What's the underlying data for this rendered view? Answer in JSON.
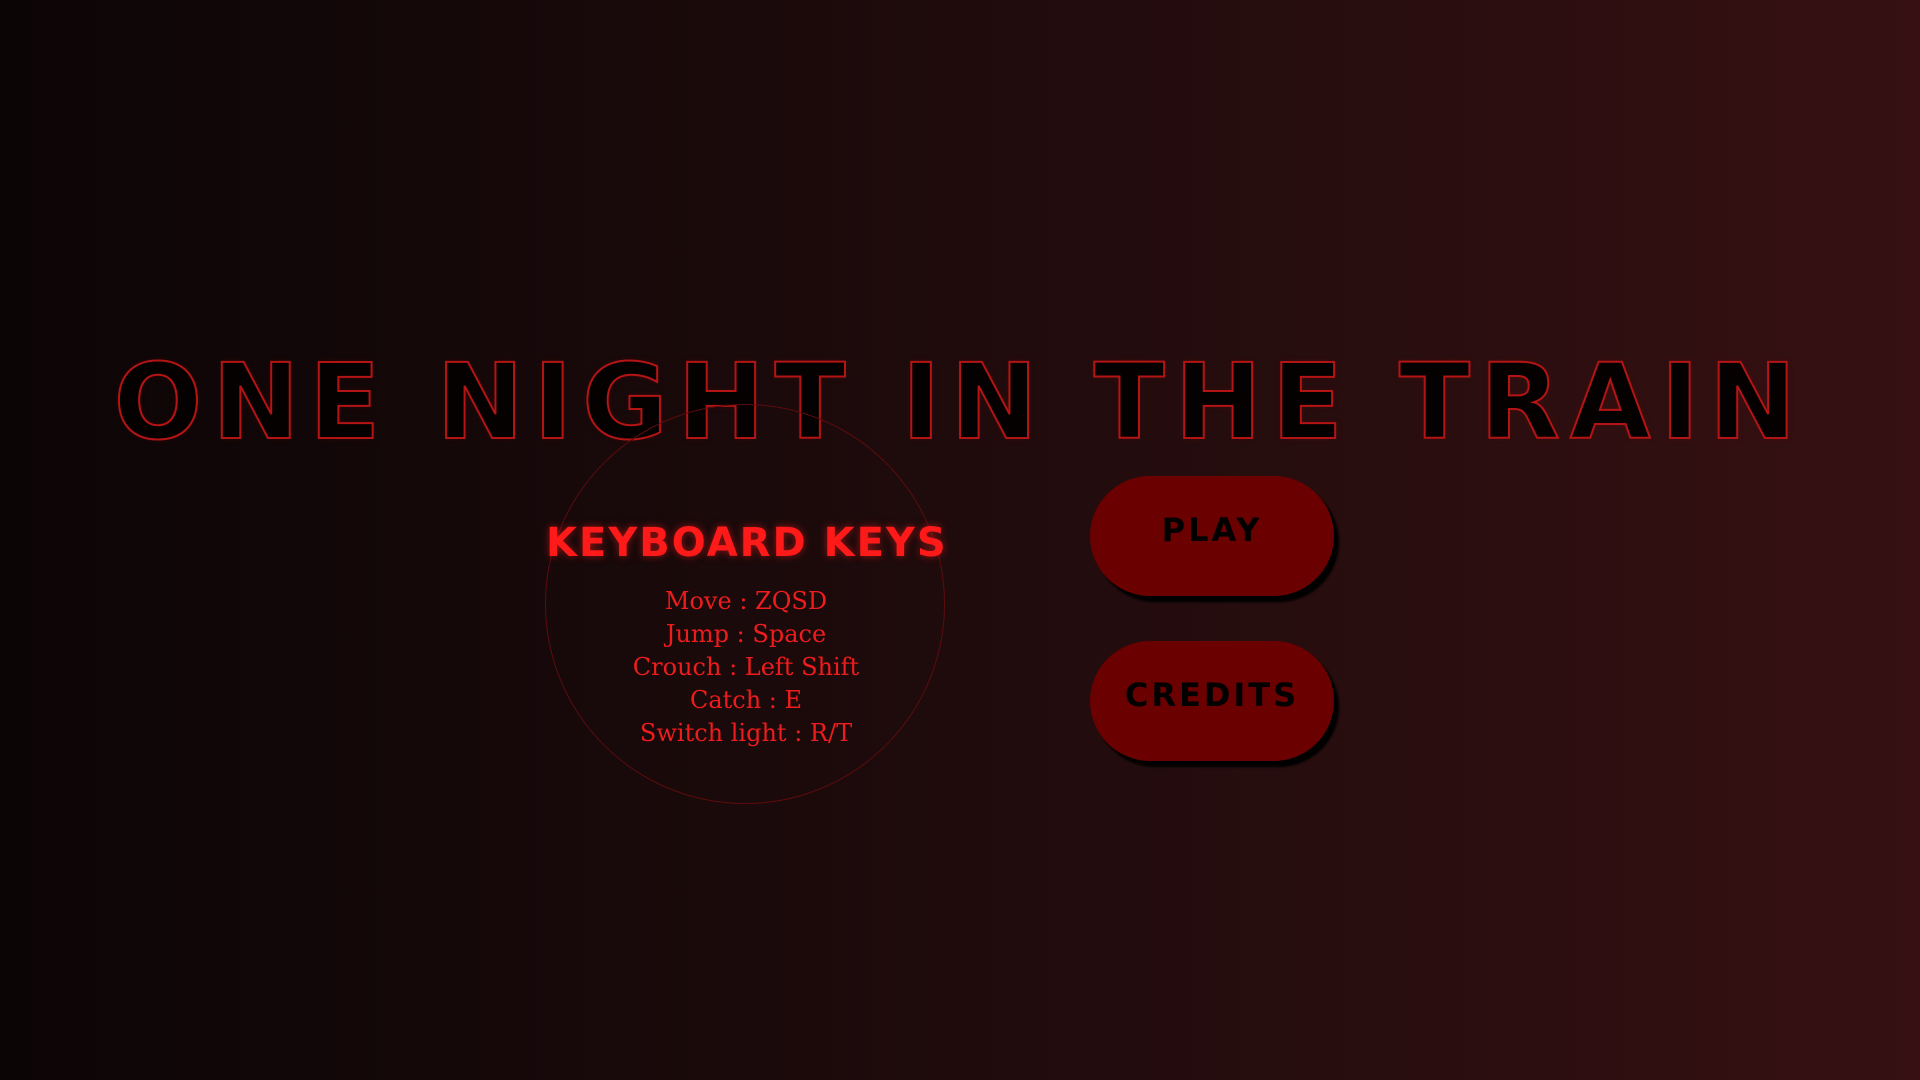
{
  "game": {
    "title": "One Night in the Train"
  },
  "keyboard_keys": {
    "heading": "Keyboard Keys",
    "items": [
      "Move : ZQSD",
      "Jump : Space",
      "Crouch : Left Shift",
      "Catch : E",
      "Switch light : R/T"
    ]
  },
  "menu": {
    "play_label": "Play",
    "credits_label": "Credits"
  },
  "colors": {
    "accent_red": "#ff1a1a",
    "button_fill": "#6a0000",
    "title_outline": "#b41414",
    "background_dark": "#0c0506",
    "background_light": "#361012"
  }
}
